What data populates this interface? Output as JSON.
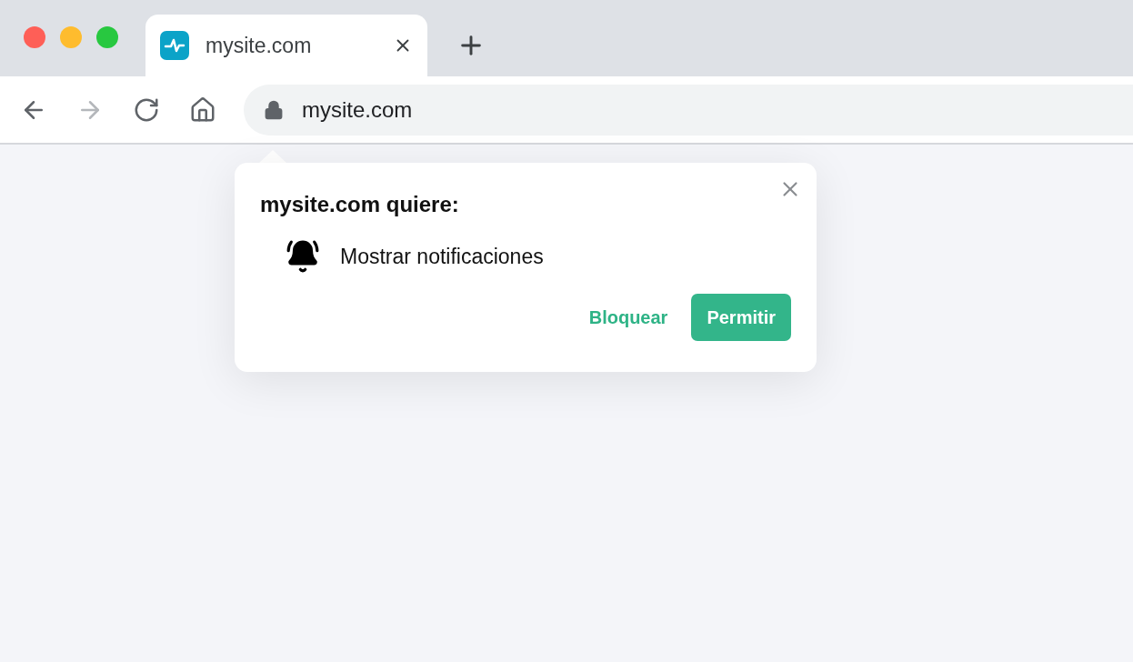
{
  "tabs": [
    {
      "title": "mysite.com",
      "selected": true
    }
  ],
  "toolbar": {
    "buttons": [
      {
        "kind": "back",
        "disabled": false
      },
      {
        "kind": "forward",
        "disabled": true
      },
      {
        "kind": "reload",
        "disabled": false
      },
      {
        "kind": "home",
        "disabled": false
      }
    ]
  },
  "address_bar": {
    "value": "mysite.com"
  },
  "permission_popup": {
    "title": "mysite.com quiere:",
    "permissions": [
      {
        "kind": "notifications",
        "label": "Mostrar notificaciones"
      }
    ],
    "buttons": [
      {
        "kind": "text",
        "label": "Bloquear"
      },
      {
        "kind": "primary",
        "label": "Permitir"
      }
    ]
  }
}
